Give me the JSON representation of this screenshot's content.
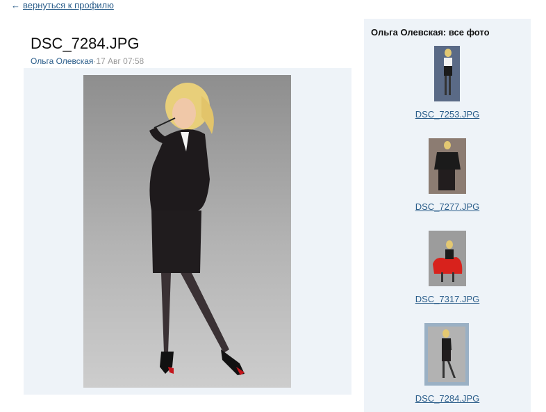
{
  "nav": {
    "back_arrow": "←",
    "back_label": "вернуться к профилю"
  },
  "photo": {
    "title": "DSC_7284.JPG",
    "author": "Ольга Олевская",
    "separator": "·",
    "date": "17 Авг 07:58"
  },
  "sidebar": {
    "title": "Ольга Олевская: все фото",
    "items": [
      {
        "label": "DSC_7253.JPG"
      },
      {
        "label": "DSC_7277.JPG"
      },
      {
        "label": "DSC_7317.JPG"
      },
      {
        "label": "DSC_7284.JPG",
        "selected": true
      }
    ]
  },
  "colors": {
    "link": "#2a5d8a",
    "panel_bg": "#eef3f8",
    "selected_border": "#9ab0c4"
  }
}
